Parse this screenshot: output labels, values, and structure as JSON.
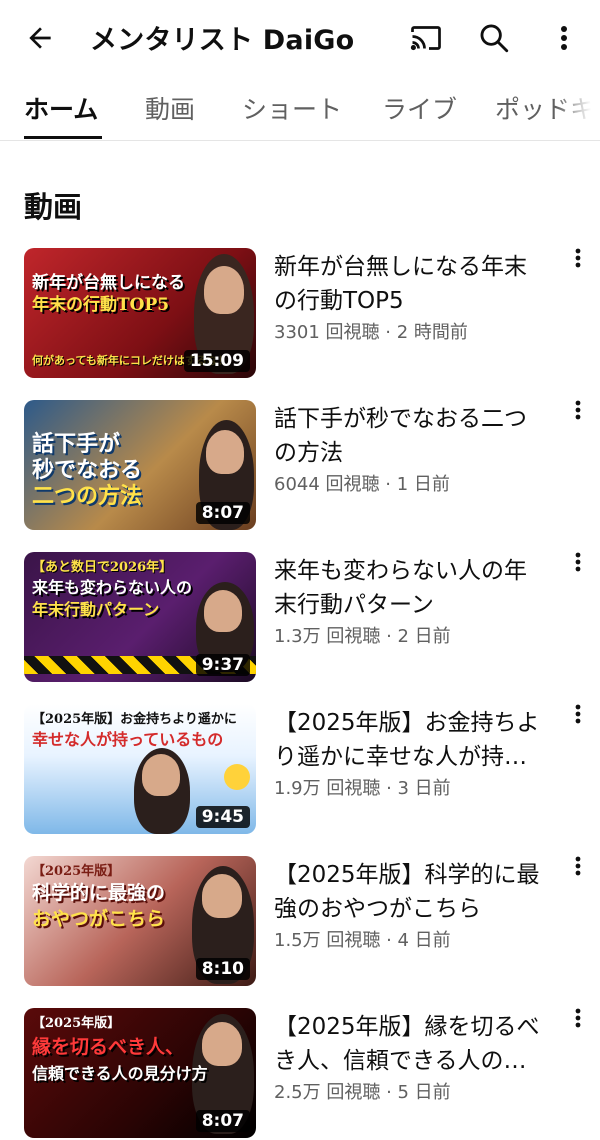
{
  "header": {
    "title": "メンタリスト DaiGo",
    "back_icon": "arrow-left-icon",
    "cast_icon": "cast-icon",
    "search_icon": "search-icon",
    "more_icon": "more-vert-icon"
  },
  "tabs": [
    {
      "label": "ホーム",
      "active": true
    },
    {
      "label": "動画",
      "active": false
    },
    {
      "label": "ショート",
      "active": false
    },
    {
      "label": "ライブ",
      "active": false
    },
    {
      "label": "ポッドキ",
      "active": false
    }
  ],
  "section": {
    "title": "動画"
  },
  "videos": [
    {
      "title_line1": "新年が台無しになる年末",
      "title_line2": "の行動TOP5",
      "views": "3301 回視聴",
      "age": "2 時間前",
      "meta": "3301 回視聴 · 2 時間前",
      "duration": "15:09",
      "thumb_line1": "新年が台無しになる",
      "thumb_line2": "年末の行動TOP5",
      "thumb_line3": "何があっても新年にコレだけはするな！"
    },
    {
      "title_line1": "話下手が秒でなおる二つ",
      "title_line2": "の方法",
      "views": "6044 回視聴",
      "age": "1 日前",
      "meta": "6044 回視聴 · 1 日前",
      "duration": "8:07",
      "thumb_line1": "話下手が",
      "thumb_line2": "秒でなおる",
      "thumb_line3": "二つの方法"
    },
    {
      "title_line1": "来年も変わらない人の年",
      "title_line2": "末行動パターン",
      "views": "1.3万 回視聴",
      "age": "2 日前",
      "meta": "1.3万 回視聴 · 2 日前",
      "duration": "9:37",
      "thumb_line1": "【あと数日で2026年】",
      "thumb_line2": "来年も変わらない人の",
      "thumb_line3": "年末行動パターン"
    },
    {
      "title_line1": "【2025年版】お金持ちよ",
      "title_line2": "り遥かに幸せな人が持っ…",
      "views": "1.9万 回視聴",
      "age": "3 日前",
      "meta": "1.9万 回視聴 · 3 日前",
      "duration": "9:45",
      "thumb_line1": "【2025年版】お金持ちより遥かに",
      "thumb_line2": "幸せな人が持っているもの",
      "thumb_line3": ""
    },
    {
      "title_line1": "【2025年版】科学的に最",
      "title_line2": "強のおやつがこちら",
      "views": "1.5万 回視聴",
      "age": "4 日前",
      "meta": "1.5万 回視聴 · 4 日前",
      "duration": "8:10",
      "thumb_line1": "【2025年版】",
      "thumb_line2": "科学的に最強の",
      "thumb_line3": "おやつがこちら"
    },
    {
      "title_line1": "【2025年版】縁を切るべ",
      "title_line2": "き人、信頼できる人の見…",
      "views": "2.5万 回視聴",
      "age": "5 日前",
      "meta": "2.5万 回視聴 · 5 日前",
      "duration": "8:07",
      "thumb_line1": "【2025年版】",
      "thumb_line2": "縁を切るべき人、",
      "thumb_line3": "信頼できる人の見分け方"
    }
  ]
}
